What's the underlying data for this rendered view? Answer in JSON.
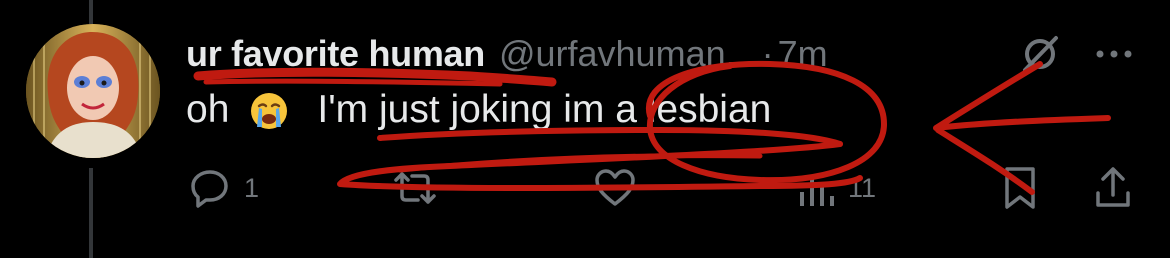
{
  "tweet": {
    "display_name": "ur favorite human",
    "handle": "@urfavhuman...",
    "separator": "·",
    "timestamp": "7m",
    "text_before_emoji": "oh",
    "emoji": "loudly-crying-face-emoji",
    "text_after_emoji": "I'm just joking im a lesbian"
  },
  "actions": {
    "reply_count": "1",
    "repost_count": "",
    "like_count": "",
    "views_count": "11"
  },
  "icons": {
    "grok": "grok-icon",
    "more": "more-icon",
    "reply": "reply-icon",
    "repost": "repost-icon",
    "like": "heart-icon",
    "views": "views-icon",
    "bookmark": "bookmark-icon",
    "share": "share-icon"
  },
  "colors": {
    "background": "#000000",
    "primary_text": "#e7e9ea",
    "secondary_text": "#71767b",
    "annotation_red": "#c01a10"
  }
}
